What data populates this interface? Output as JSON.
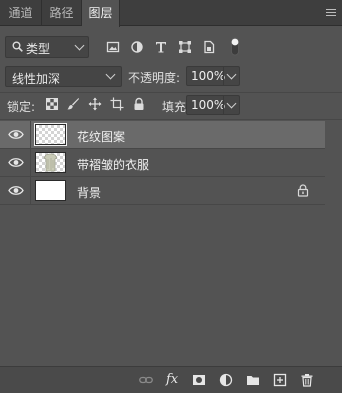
{
  "tabs": [
    {
      "label": "通道",
      "active": false
    },
    {
      "label": "路径",
      "active": false
    },
    {
      "label": "图层",
      "active": true
    }
  ],
  "filter": {
    "kind_label": "类型",
    "icons": [
      "pixel-layer-filter-icon",
      "adjustment-layer-filter-icon",
      "type-layer-filter-icon",
      "shape-layer-filter-icon",
      "smart-object-filter-icon",
      "filter-toggle-icon"
    ]
  },
  "blend": {
    "mode": "线性加深",
    "opacity_label": "不透明度:",
    "opacity_value": "100%"
  },
  "lock": {
    "label": "锁定:",
    "icons": [
      "lock-transparent-pixels-icon",
      "lock-image-pixels-icon",
      "lock-position-icon",
      "lock-artboard-icon",
      "lock-all-icon"
    ],
    "fill_label": "填充:",
    "fill_value": "100%"
  },
  "layers": [
    {
      "name": "花纹图案",
      "visible": true,
      "selected": true,
      "locked": false,
      "thumb": "checker"
    },
    {
      "name": "带褶皱的衣服",
      "visible": true,
      "selected": false,
      "locked": false,
      "thumb": "checker"
    },
    {
      "name": "背景",
      "visible": true,
      "selected": false,
      "locked": true,
      "thumb": "white"
    }
  ],
  "footer": {
    "icons": [
      "link-layers-icon",
      "fx-icon",
      "add-mask-icon",
      "new-adjustment-icon",
      "new-group-icon",
      "new-layer-icon",
      "delete-layer-icon"
    ],
    "fx_label": "fx"
  },
  "colors": {
    "panel_bg": "#535353",
    "selected_layer_bg": "#6a6a6a",
    "tab_bar_bg": "#3e3e3e"
  }
}
